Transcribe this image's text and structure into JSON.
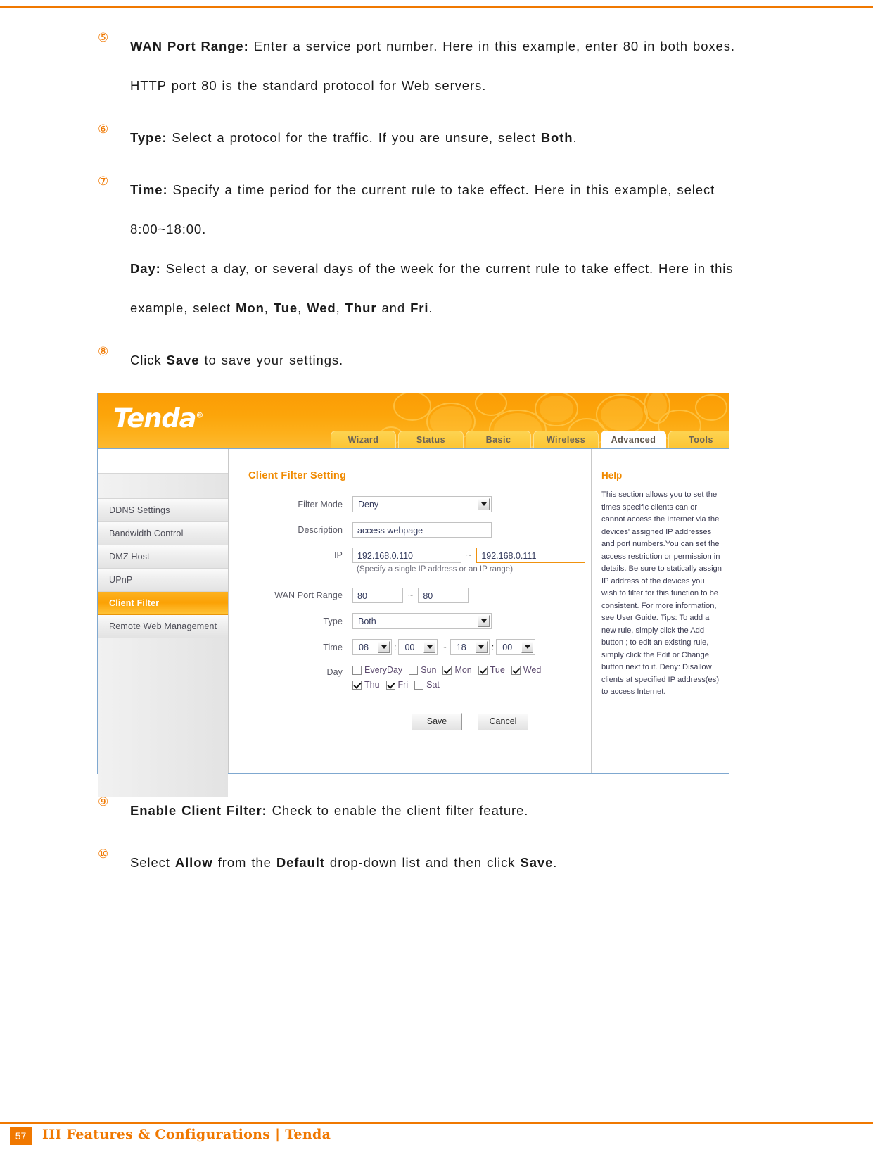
{
  "document": {
    "steps": [
      {
        "num": "⑤",
        "segments": [
          {
            "text": "WAN Port Range:",
            "bold": true
          },
          {
            "text": " Enter a service port number. Here in this example, enter 80 in both boxes. HTTP port 80 is the standard protocol for Web servers.",
            "bold": false
          }
        ]
      },
      {
        "num": "⑥",
        "segments": [
          {
            "text": "Type:",
            "bold": true
          },
          {
            "text": " Select a protocol for the traffic. If you are unsure, select ",
            "bold": false
          },
          {
            "text": "Both",
            "bold": true
          },
          {
            "text": ".",
            "bold": false
          }
        ]
      },
      {
        "num": "⑦",
        "segments": [
          {
            "text": "Time:",
            "bold": true
          },
          {
            "text": " Specify a time period for the current rule to take effect. Here in this example, select 8:00~18:00.",
            "bold": false
          },
          {
            "text": "BREAK",
            "bold": false
          },
          {
            "text": "Day:",
            "bold": true
          },
          {
            "text": " Select a day, or several days of the week for the current rule to take effect. Here in this example, select ",
            "bold": false
          },
          {
            "text": "Mon",
            "bold": true
          },
          {
            "text": ", ",
            "bold": false
          },
          {
            "text": "Tue",
            "bold": true
          },
          {
            "text": ", ",
            "bold": false
          },
          {
            "text": "Wed",
            "bold": true
          },
          {
            "text": ", ",
            "bold": false
          },
          {
            "text": "Thur",
            "bold": true
          },
          {
            "text": " and ",
            "bold": false
          },
          {
            "text": "Fri",
            "bold": true
          },
          {
            "text": ".",
            "bold": false
          }
        ]
      },
      {
        "num": "⑧",
        "segments": [
          {
            "text": "Click ",
            "bold": false
          },
          {
            "text": "Save",
            "bold": true
          },
          {
            "text": " to save your settings.",
            "bold": false
          }
        ]
      }
    ],
    "steps_after": [
      {
        "num": "⑨",
        "segments": [
          {
            "text": "Enable Client Filter:",
            "bold": true
          },
          {
            "text": " Check to enable the client filter feature.",
            "bold": false
          }
        ]
      },
      {
        "num": "⑩",
        "segments": [
          {
            "text": "Select ",
            "bold": false
          },
          {
            "text": "Allow",
            "bold": true
          },
          {
            "text": " from the ",
            "bold": false
          },
          {
            "text": "Default",
            "bold": true
          },
          {
            "text": " drop-down list and then click ",
            "bold": false
          },
          {
            "text": "Save",
            "bold": true
          },
          {
            "text": ".",
            "bold": false
          }
        ]
      }
    ],
    "footer": {
      "page_number": "57",
      "text": "III Features & Configurations | Tenda"
    }
  },
  "router_ui": {
    "brand": "Tenda",
    "brand_mark": "®",
    "tabs": [
      {
        "label": "Wizard",
        "active": false
      },
      {
        "label": "Status",
        "active": false
      },
      {
        "label": "Basic",
        "active": false
      },
      {
        "label": "Wireless",
        "active": false
      },
      {
        "label": "Advanced",
        "active": true
      },
      {
        "label": "Tools",
        "active": false
      }
    ],
    "sidebar": {
      "items": [
        {
          "label": "DDNS Settings",
          "selected": false
        },
        {
          "label": "Bandwidth Control",
          "selected": false
        },
        {
          "label": "DMZ Host",
          "selected": false
        },
        {
          "label": "UPnP",
          "selected": false
        },
        {
          "label": "Client Filter",
          "selected": true
        },
        {
          "label": "Remote Web Management",
          "selected": false
        }
      ]
    },
    "form": {
      "section_title": "Client Filter Setting",
      "filter_mode": {
        "label": "Filter Mode",
        "value": "Deny"
      },
      "description": {
        "label": "Description",
        "value": "access webpage"
      },
      "ip": {
        "label": "IP",
        "start": "192.168.0.110",
        "end": "192.168.0.111",
        "separator": "~",
        "hint": "(Specify a single IP address or an IP range)"
      },
      "wan_port_range": {
        "label": "WAN Port Range",
        "start": "80",
        "end": "80",
        "separator": "~"
      },
      "type": {
        "label": "Type",
        "value": "Both"
      },
      "time": {
        "label": "Time",
        "start_hour": "08",
        "start_min": "00",
        "end_hour": "18",
        "end_min": "00",
        "separator": "~",
        "colon": ":"
      },
      "day": {
        "label": "Day",
        "options": [
          {
            "label": "EveryDay",
            "checked": false
          },
          {
            "label": "Sun",
            "checked": false
          },
          {
            "label": "Mon",
            "checked": true
          },
          {
            "label": "Tue",
            "checked": true
          },
          {
            "label": "Wed",
            "checked": true
          },
          {
            "label": "Thu",
            "checked": true
          },
          {
            "label": "Fri",
            "checked": true
          },
          {
            "label": "Sat",
            "checked": false
          }
        ]
      },
      "save_button": "Save",
      "cancel_button": "Cancel"
    },
    "help": {
      "title": "Help",
      "body": "This section allows you to set the times specific clients can or cannot access the Internet via the devices' assigned IP addresses and port numbers.You can set the access restriction or permission in details. Be sure to statically assign IP address of the devices you wish to filter for this function to be consistent. For more information, see User Guide. Tips: To add a new rule, simply click the Add button ; to edit an existing rule, simply click the Edit or Change button next to it. Deny: Disallow clients at specified IP address(es) to access Internet."
    },
    "colors": {
      "brand_orange": "#f07800",
      "header_orange": "#fca50a",
      "tab_yellow": "#fdc533",
      "highlight_border": "#f0920e"
    }
  }
}
